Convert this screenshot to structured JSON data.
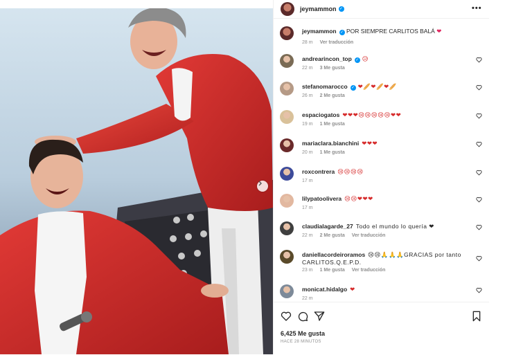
{
  "post": {
    "author": "jeymammon",
    "more_icon": "more-horizontal-icon",
    "caption_user": "jeymammon",
    "caption_text": "POR SIEMPRE CARLITOS BALÁ",
    "caption_emoji": "❤",
    "caption_time": "28 m",
    "caption_translate": "Ver traducción",
    "likes": "6,425 Me gusta",
    "time_ago": "HACE 28 MINUTOS"
  },
  "comments": [
    {
      "user": "andrearincon_top",
      "verified": true,
      "text": "😥",
      "time": "22 m",
      "likes": "3 Me gusta",
      "translate": "",
      "avatar_color": "#7a6b55"
    },
    {
      "user": "stefanomarocco",
      "verified": true,
      "text": "❤🥖❤🥖❤🥖",
      "time": "26 m",
      "likes": "2 Me gusta",
      "translate": "",
      "avatar_color": "#b59a86"
    },
    {
      "user": "espaciogatos",
      "verified": false,
      "text": "❤❤❤😢😢😢😢😢❤❤",
      "time": "19 m",
      "likes": "1 Me gusta",
      "translate": "",
      "avatar_color": "#d9c19a"
    },
    {
      "user": "mariaclara.bianchini",
      "verified": false,
      "text": "❤❤❤",
      "time": "20 m",
      "likes": "1 Me gusta",
      "translate": "",
      "avatar_color": "#6a2a2a"
    },
    {
      "user": "roxcontrera",
      "verified": false,
      "text": "😢😢😢😢",
      "time": "17 m",
      "likes": "",
      "translate": "",
      "avatar_color": "#3d4b9a"
    },
    {
      "user": "lilypatoolivera",
      "verified": false,
      "text": "😢😢❤❤❤",
      "time": "17 m",
      "likes": "",
      "translate": "",
      "avatar_color": "#e2b8a0"
    },
    {
      "user": "claudialagarde_27",
      "verified": false,
      "text": "Todo el mundo lo quería ❤",
      "time": "22 m",
      "likes": "2 Me gusta",
      "translate": "Ver traducción",
      "avatar_color": "#3f3f3f"
    },
    {
      "user": "daniellacordeiroramos",
      "verified": false,
      "text": "😢😢🙏🙏🙏GRACIAS por tanto CARLITOS.Q.E.P.D.",
      "time": "23 m",
      "likes": "1 Me gusta",
      "translate": "Ver traducción",
      "avatar_color": "#5a4a2a"
    },
    {
      "user": "monicat.hidalgo",
      "verified": false,
      "text": "❤",
      "time": "22 m",
      "likes": "",
      "translate": "",
      "avatar_color": "#7d8a99"
    }
  ],
  "actions": {
    "like_icon": "heart-icon",
    "comment_icon": "comment-icon",
    "share_icon": "send-icon",
    "save_icon": "bookmark-icon",
    "next_icon": "chevron-right-icon"
  },
  "colors": {
    "link": "#00376b",
    "muted": "#8e8e8e",
    "verified": "#0095f6",
    "jacket_red": "#d32a2a"
  }
}
